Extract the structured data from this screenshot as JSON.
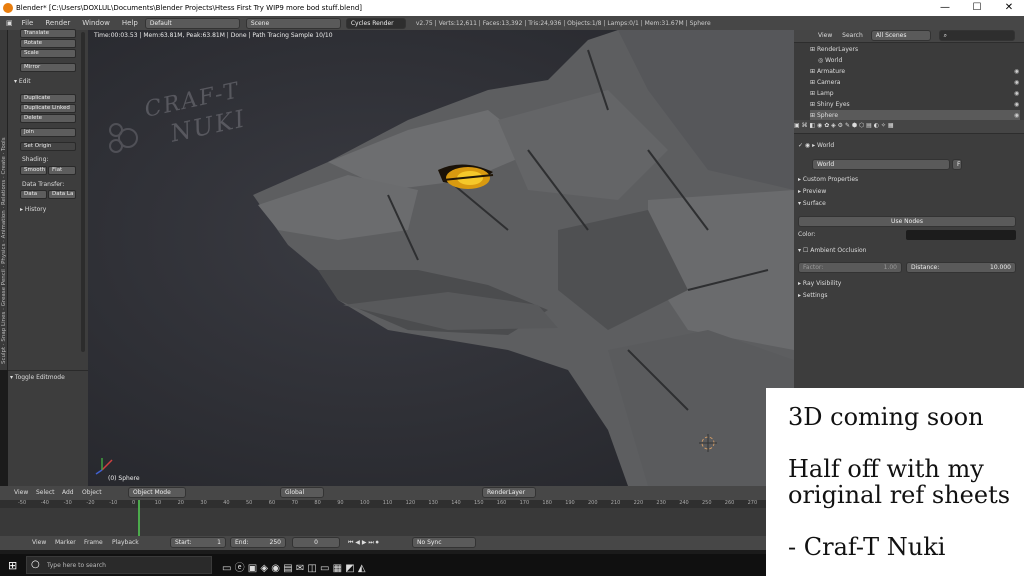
{
  "window": {
    "title": "Blender* [C:\\Users\\DOXLUL\\Documents\\Blender Projects\\Htess First Try WIP9 more bod stuff.blend]",
    "min": "—",
    "max": "☐",
    "close": "✕"
  },
  "menubar": {
    "items": [
      "File",
      "Render",
      "Window",
      "Help"
    ],
    "layout": "Default",
    "scene": "Scene",
    "engine": "Cycles Render",
    "stats": "v2.75 | Verts:12,611 | Faces:13,392 | Tris:24,936 | Objects:1/8 | Lamps:0/1 | Mem:31.67M | Sphere"
  },
  "toolstrip": {
    "tabs": [
      "Tools",
      "Create",
      "Relations",
      "Animation",
      "Physics",
      "Grease Pencil",
      "Snap Lines",
      "Sculpt"
    ]
  },
  "toolshelf": {
    "buttons": [
      "Translate",
      "Rotate",
      "Scale",
      "Mirror"
    ],
    "edit_header": "Edit",
    "edit_buttons": [
      "Duplicate",
      "Duplicate Linked",
      "Delete",
      "Join"
    ],
    "set_origin": "Set Origin",
    "shading_label": "Shading:",
    "smooth": "Smooth",
    "flat": "Flat",
    "data_transfer_label": "Data Transfer:",
    "data": "Data",
    "data_la": "Data La",
    "history": "History"
  },
  "ops": {
    "toggle": "Toggle Editmode"
  },
  "viewport": {
    "render_info": "Time:00:03.53 | Mem:63.81M, Peak:63.81M | Done | Path Tracing Sample 10/10",
    "object_label": "(0) Sphere",
    "watermark_top": "CRAF-T",
    "watermark_bottom": "NUKI"
  },
  "outliner": {
    "view": "View",
    "search": "Search",
    "filter": "All Scenes",
    "items": [
      "RenderLayers",
      "World",
      "Armature",
      "Camera",
      "Lamp",
      "Shiny Eyes",
      "Sphere"
    ]
  },
  "props": {
    "world_path": "World",
    "world_name": "World",
    "world_f": "F",
    "panels": [
      "Custom Properties",
      "Preview"
    ],
    "surface": "Surface",
    "use_nodes": "Use Nodes",
    "color_label": "Color:",
    "ao": "Ambient Occlusion",
    "factor_label": "Factor:",
    "factor_val": "1.00",
    "distance_label": "Distance:",
    "distance_val": "10.000",
    "ray_visibility": "Ray Visibility",
    "settings": "Settings"
  },
  "vheader": {
    "menus": [
      "View",
      "Select",
      "Add",
      "Object"
    ],
    "mode": "Object Mode",
    "orientation": "Global",
    "render_layer": "RenderLayer"
  },
  "timeline": {
    "ticks": [
      "-50",
      "-40",
      "-30",
      "-20",
      "-10",
      "0",
      "10",
      "20",
      "30",
      "40",
      "50",
      "60",
      "70",
      "80",
      "90",
      "100",
      "110",
      "120",
      "130",
      "140",
      "150",
      "160",
      "170",
      "180",
      "190",
      "200",
      "210",
      "220",
      "230",
      "240",
      "250",
      "260",
      "270"
    ],
    "menus": [
      "View",
      "Marker",
      "Frame",
      "Playback"
    ],
    "start_label": "Start:",
    "start_val": "1",
    "end_label": "End:",
    "end_val": "250",
    "current": "0",
    "sync": "No Sync"
  },
  "taskbar": {
    "search": "Type here to search"
  },
  "overlay": {
    "line1": "3D coming soon",
    "line2": "Half off with my original ref sheets",
    "line3": "- Craf-T Nuki"
  }
}
